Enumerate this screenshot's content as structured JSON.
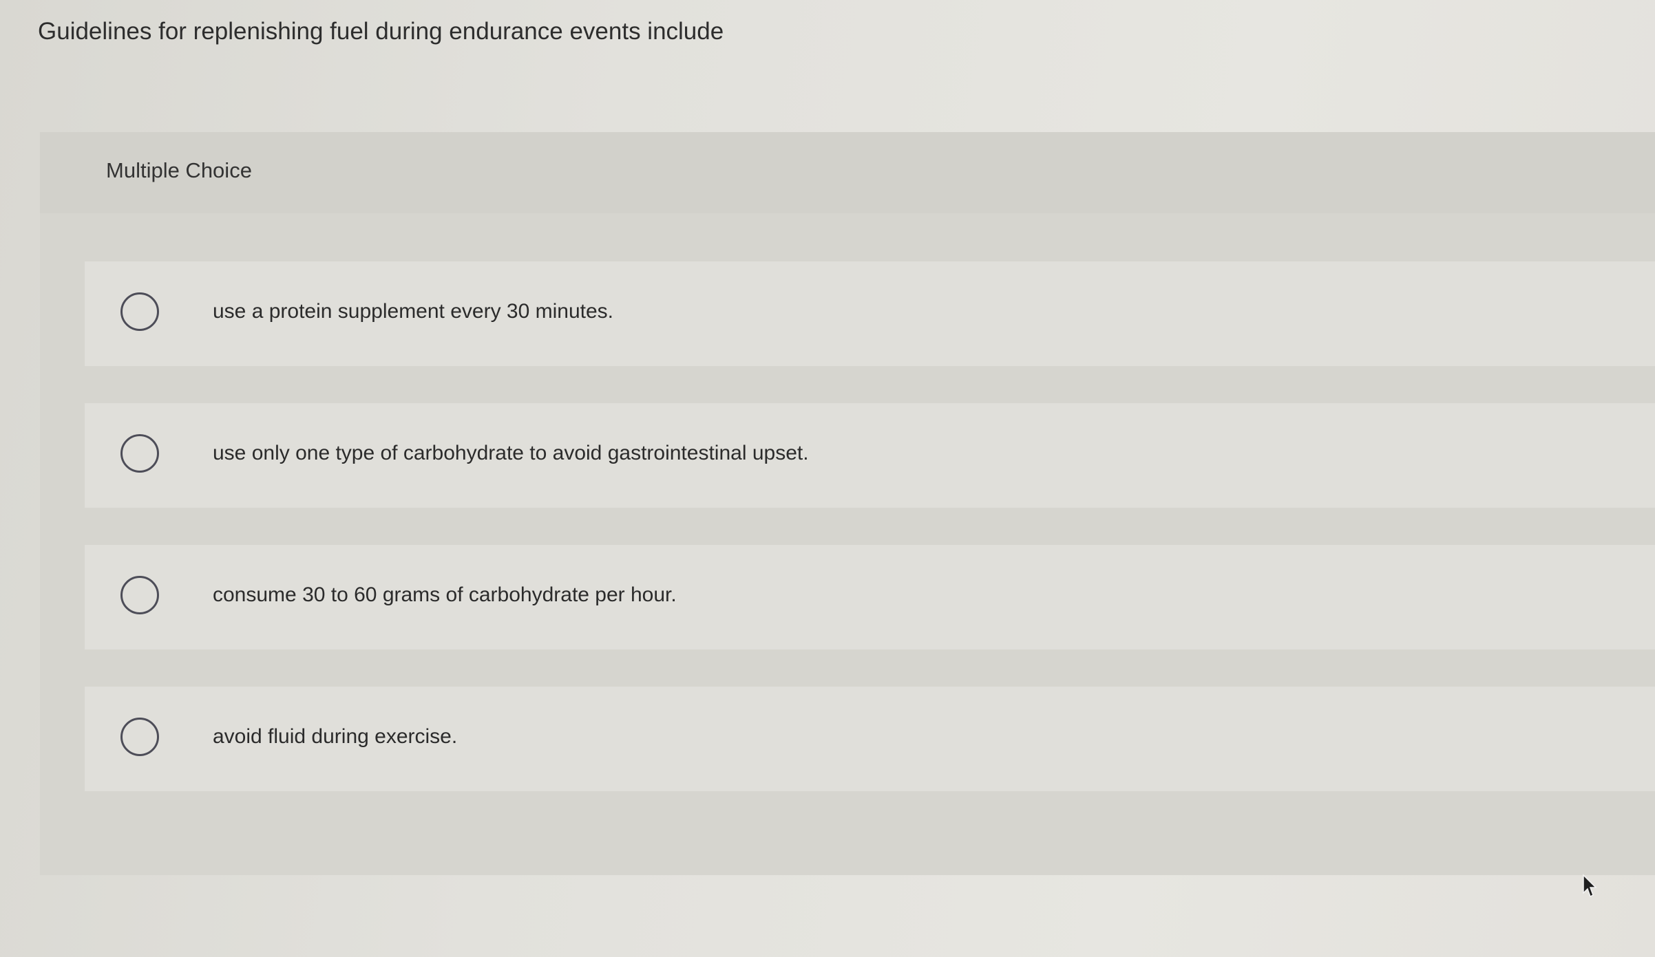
{
  "question": {
    "text": "Guidelines for replenishing fuel during endurance events include"
  },
  "panel": {
    "label": "Multiple Choice"
  },
  "options": [
    {
      "text": "use a protein supplement every 30 minutes.",
      "selected": false
    },
    {
      "text": "use only one type of carbohydrate to avoid gastrointestinal upset.",
      "selected": false
    },
    {
      "text": "consume 30 to 60 grams of carbohydrate per hour.",
      "selected": false
    },
    {
      "text": "avoid fluid during exercise.",
      "selected": false
    }
  ],
  "icons": {
    "radio": "radio-unselected-icon",
    "cursor": "mouse-pointer-icon"
  },
  "colors": {
    "background": "#e2e1dc",
    "panel": "#d6d5cf",
    "option_row": "#e0dfda",
    "radio_border": "#4d4d58",
    "text": "#2b2b2b"
  }
}
